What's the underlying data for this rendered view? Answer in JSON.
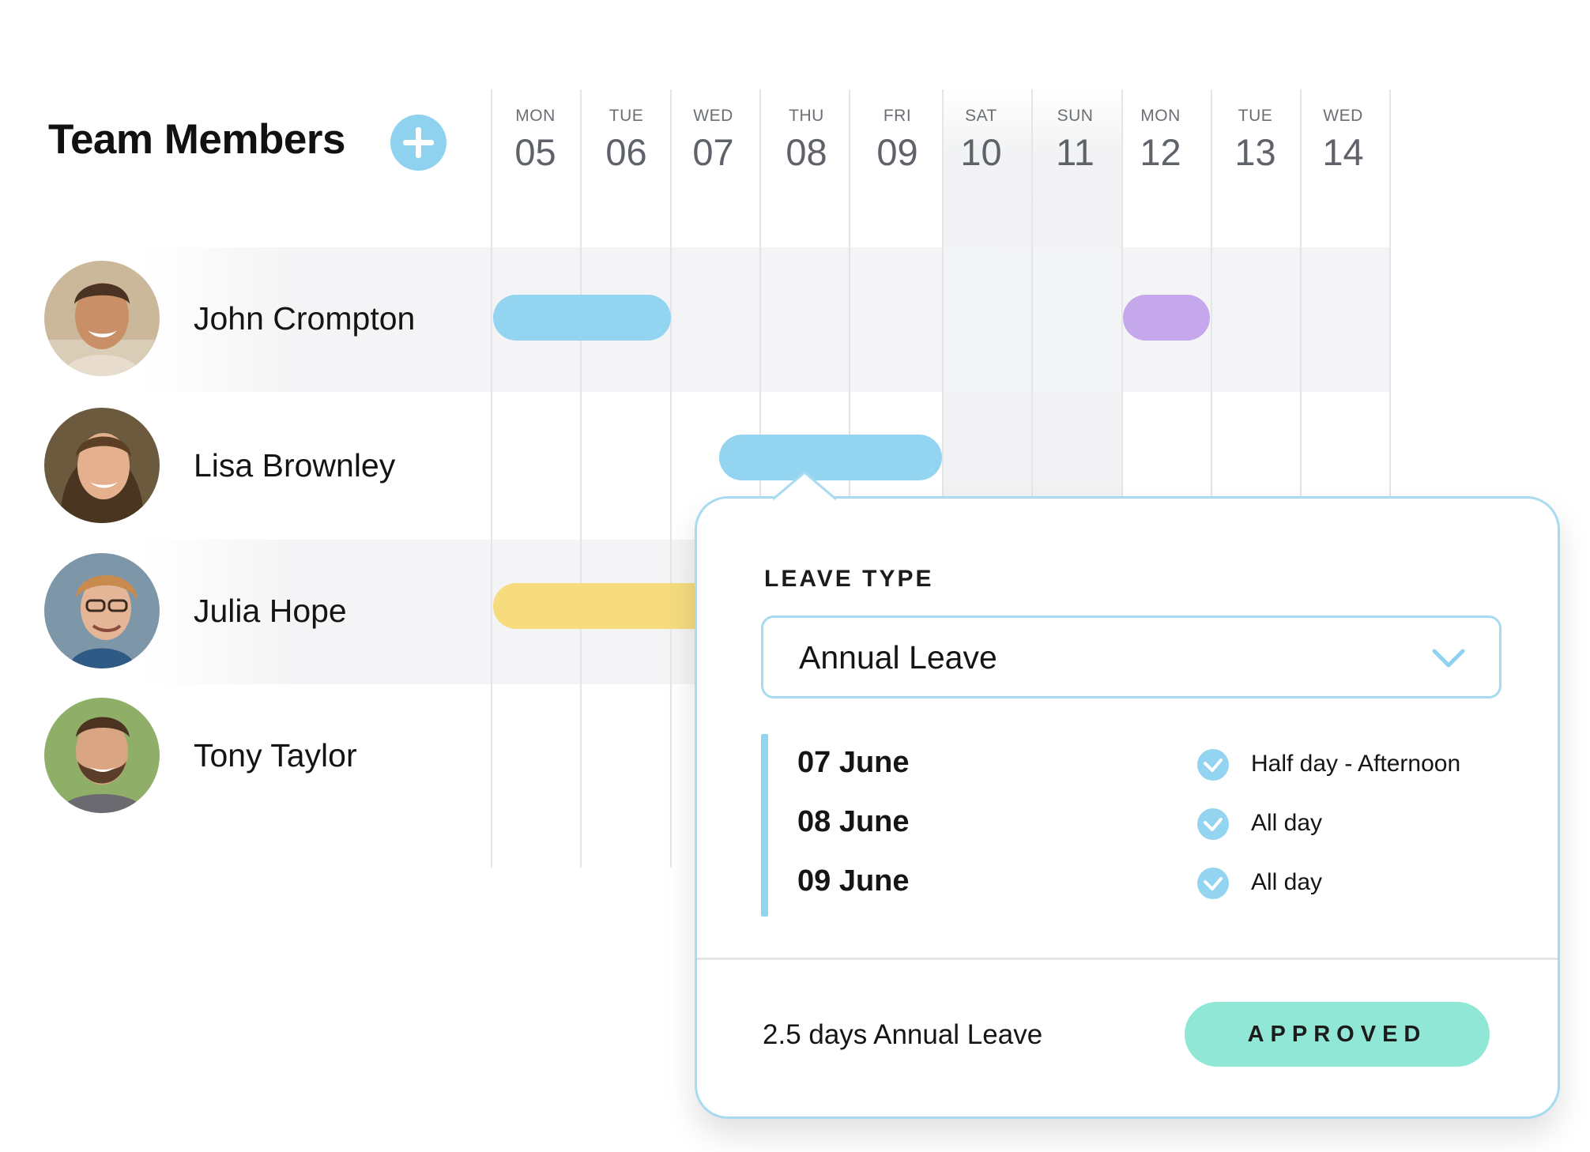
{
  "header": {
    "title": "Team Members",
    "add_icon": "plus-circle-icon",
    "accent_color": "#8fd2ef"
  },
  "days": [
    {
      "name": "MON",
      "num": "05",
      "weekend": false
    },
    {
      "name": "TUE",
      "num": "06",
      "weekend": false
    },
    {
      "name": "WED",
      "num": "07",
      "weekend": false
    },
    {
      "name": "THU",
      "num": "08",
      "weekend": false
    },
    {
      "name": "FRI",
      "num": "09",
      "weekend": false
    },
    {
      "name": "SAT",
      "num": "10",
      "weekend": true
    },
    {
      "name": "SUN",
      "num": "11",
      "weekend": true
    },
    {
      "name": "MON",
      "num": "12",
      "weekend": false
    },
    {
      "name": "TUE",
      "num": "13",
      "weekend": false
    },
    {
      "name": "WED",
      "num": "14",
      "weekend": false
    }
  ],
  "members": [
    {
      "name": "John Crompton"
    },
    {
      "name": "Lisa Brownley"
    },
    {
      "name": "Julia Hope"
    },
    {
      "name": "Tony Taylor"
    }
  ],
  "leave_bars": [
    {
      "member": "John Crompton",
      "start_day": "05",
      "end_day": "06",
      "color": "#93d4f0"
    },
    {
      "member": "John Crompton",
      "start_day": "12",
      "end_day": "12",
      "color": "#c5a8ec"
    },
    {
      "member": "Lisa Brownley",
      "start_day": "07",
      "end_day": "09",
      "color": "#93d4f0"
    },
    {
      "member": "Julia Hope",
      "start_day": "05",
      "end_day": "07",
      "color": "#f6dc7f"
    }
  ],
  "popover": {
    "leave_type_label": "LEAVE TYPE",
    "leave_type_value": "Annual Leave",
    "dropdown_icon": "chevron-down-icon",
    "dates": [
      {
        "date": "07 June",
        "type": "Half day - Afternoon"
      },
      {
        "date": "08 June",
        "type": "All day"
      },
      {
        "date": "09 June",
        "type": "All day"
      }
    ],
    "check_icon": "check-circle-icon",
    "summary": "2.5 days Annual Leave",
    "status_button": "APPROVED",
    "status_color": "#90e7d5"
  }
}
